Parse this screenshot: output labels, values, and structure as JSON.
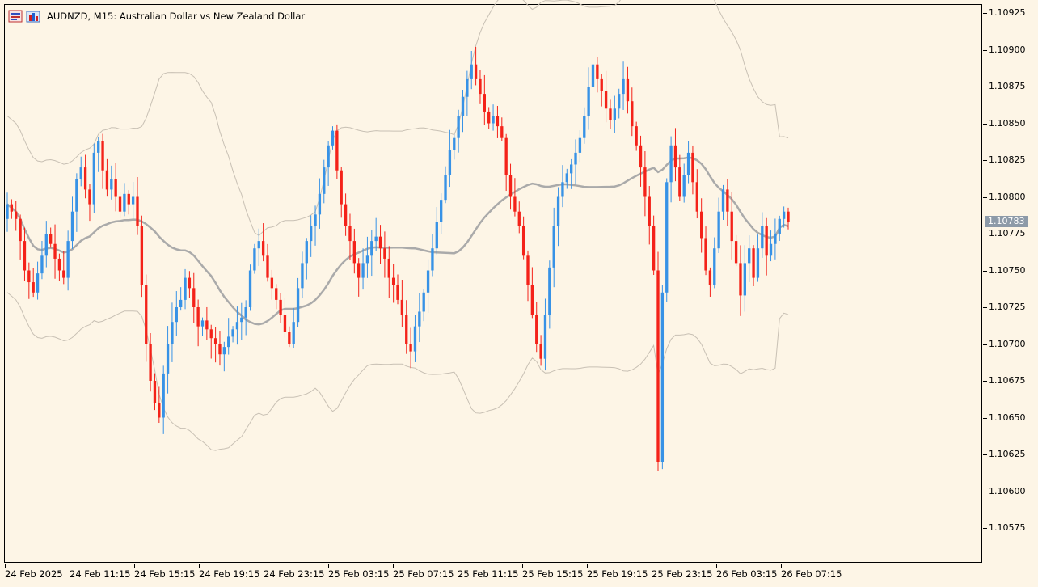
{
  "header": {
    "symbol_title": "AUDNZD, M15:  Australian Dollar vs New Zealand Dollar",
    "icons": [
      "one-click-trading-icon",
      "depth-of-market-icon"
    ]
  },
  "colors": {
    "background": "#fdf5e6",
    "bull": "#3792e6",
    "bear": "#f42219",
    "ma": "#aaaaaa",
    "bands": "#c8c0b4",
    "bid_line": "#8d9aa8"
  },
  "price_axis": {
    "labels": [
      "1.10925",
      "1.10900",
      "1.10875",
      "1.10850",
      "1.10825",
      "1.10800",
      "1.10775",
      "1.10750",
      "1.10725",
      "1.10700",
      "1.10675",
      "1.10650",
      "1.10625",
      "1.10600",
      "1.10575"
    ],
    "current_price": "1.10783"
  },
  "time_axis": {
    "labels": [
      "24 Feb 2025",
      "24 Feb 11:15",
      "24 Feb 15:15",
      "24 Feb 19:15",
      "24 Feb 23:15",
      "25 Feb 03:15",
      "25 Feb 07:15",
      "25 Feb 11:15",
      "25 Feb 15:15",
      "25 Feb 19:15",
      "25 Feb 23:15",
      "26 Feb 03:15",
      "26 Feb 07:15"
    ]
  },
  "chart_data": {
    "type": "candlestick",
    "symbol": "AUDNZD",
    "timeframe": "M15",
    "y_range": [
      1.1056,
      1.10935
    ],
    "current_price": 1.10783,
    "closes": [
      1.10795,
      1.1079,
      1.10785,
      1.1077,
      1.1075,
      1.10742,
      1.10735,
      1.10748,
      1.1076,
      1.10775,
      1.10768,
      1.10758,
      1.1075,
      1.10745,
      1.1077,
      1.1079,
      1.10812,
      1.1082,
      1.10805,
      1.10795,
      1.1083,
      1.10838,
      1.10818,
      1.10805,
      1.10812,
      1.108,
      1.1079,
      1.10802,
      1.10795,
      1.108,
      1.1078,
      1.1074,
      1.107,
      1.10675,
      1.1066,
      1.1065,
      1.1068,
      1.107,
      1.10715,
      1.10725,
      1.1073,
      1.10745,
      1.10738,
      1.10725,
      1.10712,
      1.10716,
      1.1071,
      1.10704,
      1.107,
      1.10693,
      1.10698,
      1.10705,
      1.1071,
      1.10715,
      1.10718,
      1.10725,
      1.1075,
      1.10765,
      1.1077,
      1.1076,
      1.10745,
      1.10738,
      1.1073,
      1.1072,
      1.10708,
      1.107,
      1.10715,
      1.10738,
      1.10755,
      1.1077,
      1.1078,
      1.10788,
      1.10802,
      1.1082,
      1.10835,
      1.10845,
      1.10818,
      1.10795,
      1.1078,
      1.1077,
      1.10755,
      1.10745,
      1.10755,
      1.1076,
      1.1077,
      1.10773,
      1.10765,
      1.10758,
      1.10745,
      1.1074,
      1.1073,
      1.1072,
      1.107,
      1.10695,
      1.10712,
      1.10722,
      1.10735,
      1.1075,
      1.10765,
      1.10783,
      1.10798,
      1.10815,
      1.10832,
      1.1084,
      1.10855,
      1.10868,
      1.1088,
      1.1089,
      1.1088,
      1.1087,
      1.10858,
      1.1085,
      1.10855,
      1.10848,
      1.1084,
      1.10815,
      1.108,
      1.1079,
      1.1078,
      1.1076,
      1.1074,
      1.1072,
      1.107,
      1.1069,
      1.1072,
      1.10752,
      1.1078,
      1.108,
      1.1081,
      1.10816,
      1.10822,
      1.1083,
      1.1084,
      1.10855,
      1.10875,
      1.1089,
      1.1088,
      1.10872,
      1.1086,
      1.10852,
      1.1086,
      1.1087,
      1.1088,
      1.10865,
      1.10848,
      1.10835,
      1.1082,
      1.108,
      1.1078,
      1.1075,
      1.1062,
      1.10735,
      1.1081,
      1.10835,
      1.1082,
      1.108,
      1.10815,
      1.1083,
      1.1081,
      1.1079,
      1.10772,
      1.1075,
      1.1074,
      1.10765,
      1.1079,
      1.10805,
      1.1079,
      1.1077,
      1.10755,
      1.10733,
      1.10755,
      1.10765,
      1.10745,
      1.10765,
      1.1078,
      1.1076,
      1.10768,
      1.10775,
      1.10785,
      1.1079,
      1.10783
    ],
    "moving_average_last": 1.10796,
    "band_upper_last": 1.1088,
    "band_lower_last": 1.10713
  }
}
